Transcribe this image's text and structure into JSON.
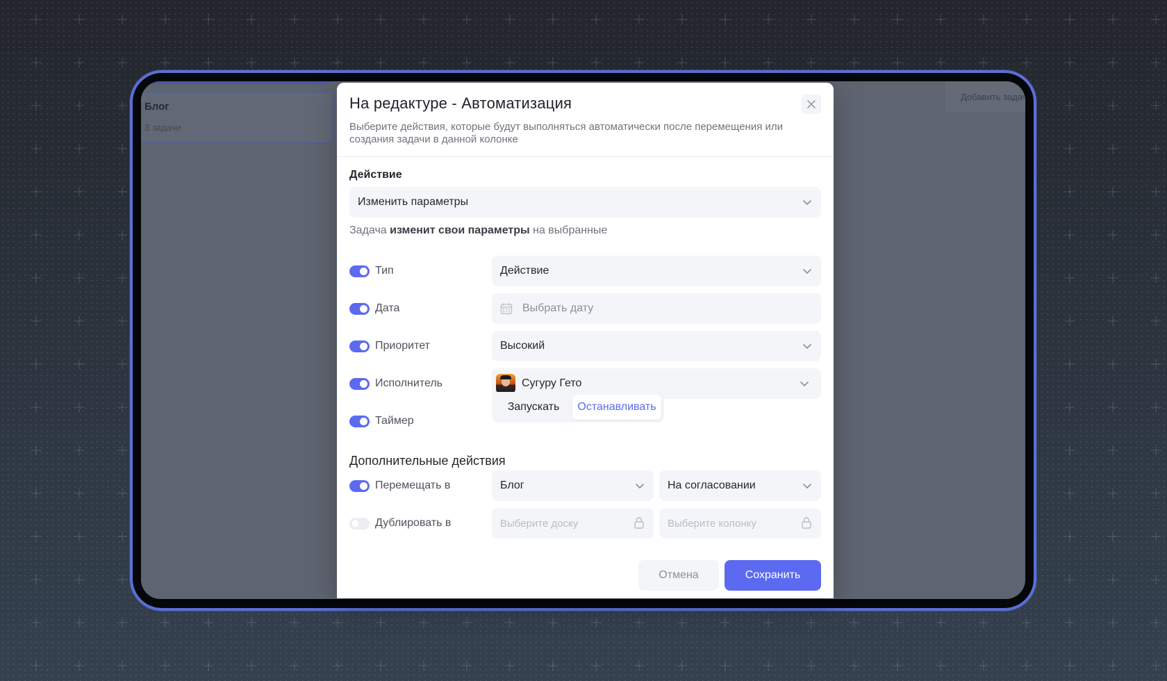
{
  "background_app": {
    "card_title": "Блог",
    "card_subtitle": "3 задачи",
    "add_task_label": "Добавить задачу"
  },
  "modal": {
    "title": "На редактуре - Автоматизация",
    "description": "Выберите действия, которые будут выполняться автоматически после перемещения или создания задачи в данной колонке",
    "action_label": "Действие",
    "action_value": "Изменить параметры",
    "hint_prefix": "Задача",
    "hint_bold": "изменит свои параметры",
    "hint_suffix": "на выбранные",
    "rows": {
      "type": {
        "label": "Тип",
        "value": "Действие",
        "enabled": true
      },
      "date": {
        "label": "Дата",
        "placeholder": "Выбрать дату",
        "enabled": true
      },
      "priority": {
        "label": "Приоритет",
        "value": "Высокий",
        "enabled": true
      },
      "assignee": {
        "label": "Исполнитель",
        "value": "Сугуру Гето",
        "enabled": true
      },
      "timer": {
        "label": "Таймер",
        "option_start": "Запускать",
        "option_stop": "Останавливать",
        "selected": "Останавливать",
        "enabled": true
      }
    },
    "extra_title": "Дополнительные действия",
    "move": {
      "label": "Перемещать в",
      "board": "Блог",
      "column": "На согласовании",
      "enabled": true
    },
    "duplicate": {
      "label": "Дублировать в",
      "board_placeholder": "Выберите доску",
      "column_placeholder": "Выберите колонку",
      "enabled": false
    },
    "cancel_label": "Отмена",
    "save_label": "Сохранить"
  },
  "colors": {
    "accent": "#5b6af0",
    "frame": "#5a6fd6",
    "field_bg": "#f4f5f8"
  }
}
